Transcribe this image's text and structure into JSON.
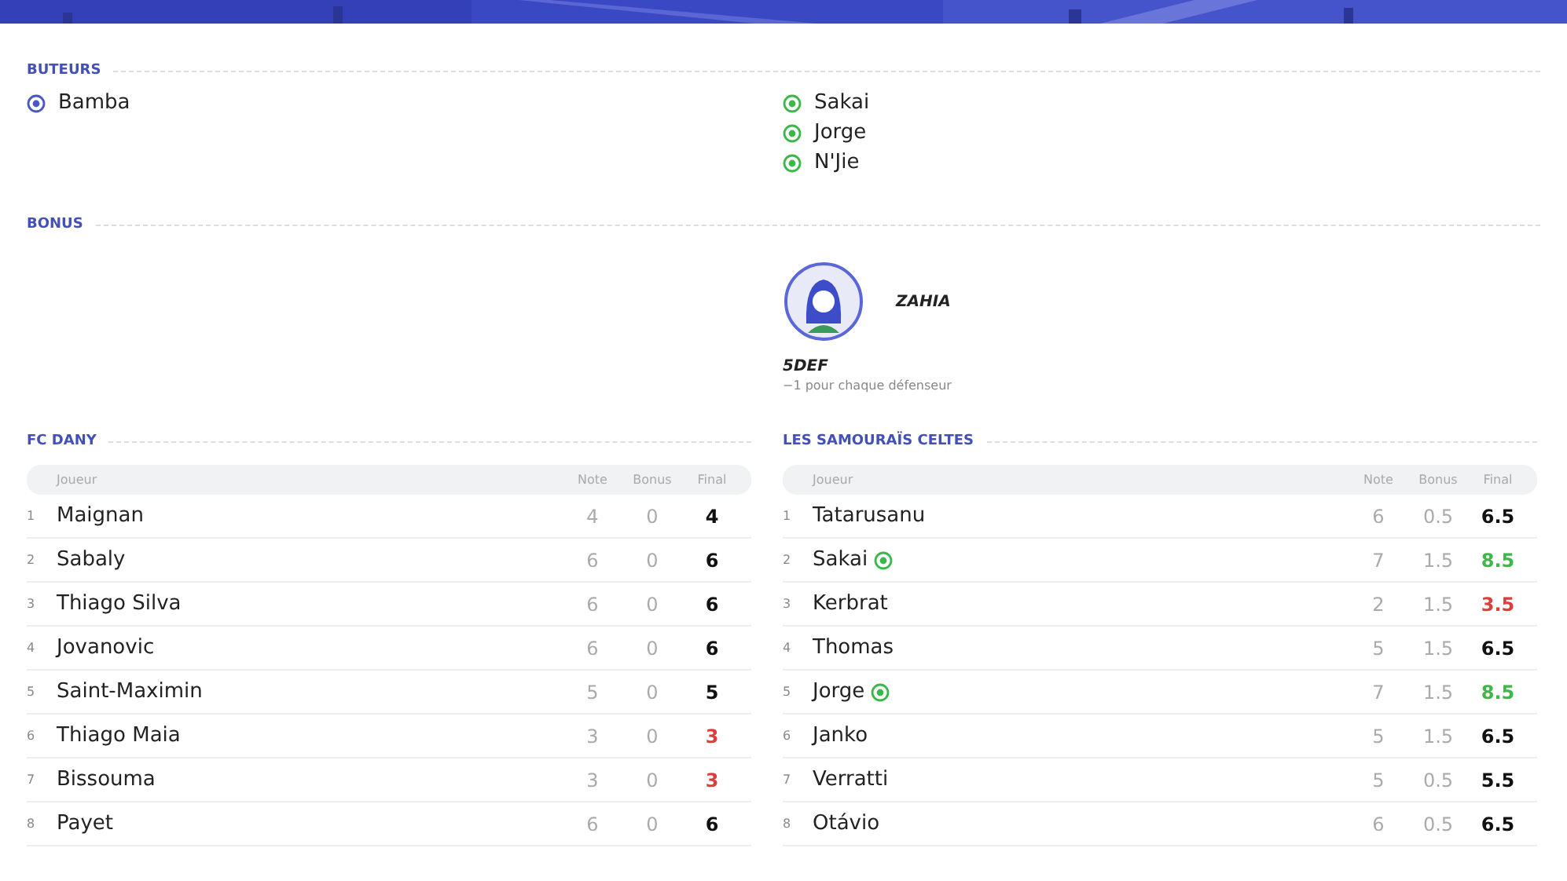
{
  "scorers": {
    "title": "BUTEURS",
    "home": [
      {
        "name": "Bamba",
        "color": "#4a57c8"
      }
    ],
    "away": [
      {
        "name": "Sakai",
        "color": "#3cb84a"
      },
      {
        "name": "Jorge",
        "color": "#3cb84a"
      },
      {
        "name": "N'Jie",
        "color": "#3cb84a"
      }
    ]
  },
  "bonus": {
    "title": "BONUS",
    "away": {
      "name": "ZAHIA",
      "code": "5DEF",
      "description": "−1 pour chaque défenseur"
    }
  },
  "teams": [
    {
      "name": "FC DANY",
      "columns": [
        "Joueur",
        "Note",
        "Bonus",
        "Final"
      ],
      "rows": [
        {
          "num": "1",
          "player": "Maignan",
          "scored": false,
          "note": "4",
          "bonus": "0",
          "final": "4",
          "color": "#111111"
        },
        {
          "num": "2",
          "player": "Sabaly",
          "scored": false,
          "note": "6",
          "bonus": "0",
          "final": "6",
          "color": "#111111"
        },
        {
          "num": "3",
          "player": "Thiago Silva",
          "scored": false,
          "note": "6",
          "bonus": "0",
          "final": "6",
          "color": "#111111"
        },
        {
          "num": "4",
          "player": "Jovanovic",
          "scored": false,
          "note": "6",
          "bonus": "0",
          "final": "6",
          "color": "#111111"
        },
        {
          "num": "5",
          "player": "Saint-Maximin",
          "scored": false,
          "note": "5",
          "bonus": "0",
          "final": "5",
          "color": "#111111"
        },
        {
          "num": "6",
          "player": "Thiago Maia",
          "scored": false,
          "note": "3",
          "bonus": "0",
          "final": "3",
          "color": "#e03c3c"
        },
        {
          "num": "7",
          "player": "Bissouma",
          "scored": false,
          "note": "3",
          "bonus": "0",
          "final": "3",
          "color": "#e03c3c"
        },
        {
          "num": "8",
          "player": "Payet",
          "scored": false,
          "note": "6",
          "bonus": "0",
          "final": "6",
          "color": "#111111"
        }
      ]
    },
    {
      "name": "LES SAMOURAÏS CELTES",
      "columns": [
        "Joueur",
        "Note",
        "Bonus",
        "Final"
      ],
      "rows": [
        {
          "num": "1",
          "player": "Tatarusanu",
          "scored": false,
          "note": "6",
          "bonus": "0.5",
          "final": "6.5",
          "color": "#111111"
        },
        {
          "num": "2",
          "player": "Sakai",
          "scored": true,
          "note": "7",
          "bonus": "1.5",
          "final": "8.5",
          "color": "#3cb84a"
        },
        {
          "num": "3",
          "player": "Kerbrat",
          "scored": false,
          "note": "2",
          "bonus": "1.5",
          "final": "3.5",
          "color": "#e03c3c"
        },
        {
          "num": "4",
          "player": "Thomas",
          "scored": false,
          "note": "5",
          "bonus": "1.5",
          "final": "6.5",
          "color": "#111111"
        },
        {
          "num": "5",
          "player": "Jorge",
          "scored": true,
          "note": "7",
          "bonus": "1.5",
          "final": "8.5",
          "color": "#3cb84a"
        },
        {
          "num": "6",
          "player": "Janko",
          "scored": false,
          "note": "5",
          "bonus": "1.5",
          "final": "6.5",
          "color": "#111111"
        },
        {
          "num": "7",
          "player": "Verratti",
          "scored": false,
          "note": "5",
          "bonus": "0.5",
          "final": "5.5",
          "color": "#111111"
        },
        {
          "num": "8",
          "player": "Otávio",
          "scored": false,
          "note": "6",
          "bonus": "0.5",
          "final": "6.5",
          "color": "#111111"
        }
      ]
    }
  ]
}
